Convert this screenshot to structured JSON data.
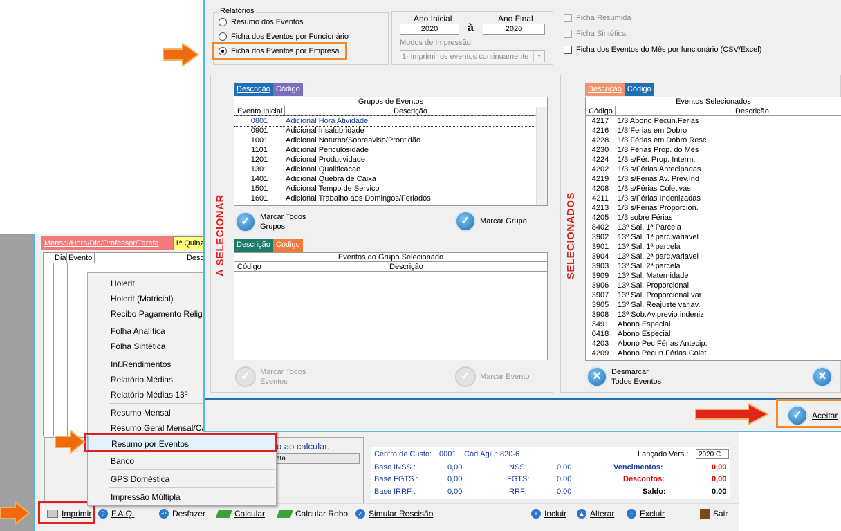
{
  "background": {
    "mode_tab": "Mensal/Hora/Dia/Professor/Tarefa",
    "quinz_tab": "1ª Quinz",
    "grid_cols": [
      "Dia",
      "Evento",
      "Desc"
    ],
    "calc_msg": "o ao calcular.",
    "calc_bar": "ata",
    "totals": {
      "centro_label": "Centro de Custo:",
      "centro_val": "0001",
      "cod_label": "Cód.Agil.:",
      "cod_val": "820-6",
      "versao_label": "Lançado Vers.:",
      "versao_val": "2020 C",
      "inss_base_label": "Base INSS :",
      "inss_base_val": "0,00",
      "inss_label": "INSS:",
      "inss_val": "0,00",
      "venc_label": "Vencimentos:",
      "venc_val": "0,00",
      "fgts_base_label": "Base FGTS :",
      "fgts_base_val": "0,00",
      "fgts_label": "FGTS:",
      "fgts_val": "0,00",
      "desc_label": "Descontos:",
      "desc_val": "0,00",
      "irrf_base_label": "Base IRRF :",
      "irrf_base_val": "0,00",
      "irrf_label": "IRRF:",
      "irrf_val": "0,00",
      "saldo_label": "Saldo:",
      "saldo_val": "0,00"
    }
  },
  "context_menu": {
    "items": [
      "Holerit",
      "Holerit (Matricial)",
      "Recibo Pagamento Religi",
      "Folha Analítica",
      "Folha Sintética",
      "Inf.Rendimentos",
      "Relatório Médias",
      "Relatório Médias 13º",
      "Resumo Mensal",
      "Resumo Geral Mensal/Ca",
      "Resumo por Eventos",
      "Banco",
      "GPS Doméstica",
      "Impressão Múltipla"
    ]
  },
  "toolbar": {
    "imprimir": "Imprimir",
    "faq": "F.A.Q.",
    "desfazer": "Desfazer",
    "calcular": "Calcular",
    "calcular_robo": "Calcular Robo",
    "simular": "Simular Rescisão",
    "incluir": "Incluir",
    "alterar": "Alterar",
    "excluir": "Excluir",
    "sair": "Sair"
  },
  "dialog": {
    "relatorios_label": "Relatórios",
    "radios": [
      "Resumo dos Eventos",
      "Ficha dos Eventos por Funcionário",
      "Ficha dos Eventos por Empresa"
    ],
    "ano_inicial_label": "Ano Inicial",
    "ano_final_label": "Ano Final",
    "ano_inicial": "2020",
    "ano_final": "2020",
    "a_label": "à",
    "modos_label": "Modos de Impressão",
    "modos_value": "1- imprimir os eventos continuamente",
    "check_ficha_resumida": "Ficha Resumida",
    "check_ficha_sintetica": "Ficha Sintética",
    "check_ficha_mes": "Ficha dos Eventos do Mês por funcionário  (CSV/Excel)",
    "a_selecionar": "A SELECIONAR",
    "selecionados": "SELECIONADOS",
    "tab_descricao": "Descrição",
    "tab_codigo": "Código",
    "grupos": {
      "title": "Grupos de Eventos",
      "col1": "Evento Inicial",
      "col2": "Descrição",
      "rows": [
        [
          "0801",
          "Adicional Hora Atividade"
        ],
        [
          "0901",
          "Adicional Insalubridade"
        ],
        [
          "1001",
          "Adicional Noturno/Sobreaviso/Prontidão"
        ],
        [
          "1101",
          "Adicional Periculosidade"
        ],
        [
          "1201",
          "Adicional Produtividade"
        ],
        [
          "1301",
          "Adicional Qualificacao"
        ],
        [
          "1401",
          "Adicional Quebra de Caixa"
        ],
        [
          "1501",
          "Adicional Tempo de Servico"
        ],
        [
          "1601",
          "Adicional Trabalho aos Domingos/Feriados"
        ]
      ]
    },
    "marcar_todos_grupos": "Marcar Todos\nGrupos",
    "marcar_grupo": "Marcar Grupo",
    "eventos_grupo": {
      "title": "Eventos do Grupo Selecionado",
      "col1": "Código",
      "col2": "Descrição"
    },
    "marcar_todos_eventos": "Marcar Todos\nEventos",
    "marcar_evento": "Marcar Evento",
    "selecionados_tbl": {
      "title": "Eventos Selecionados",
      "col1": "Código",
      "col2": "Descrição",
      "rows": [
        [
          "4217",
          "1/3 Abono Pecun.Ferias"
        ],
        [
          "4216",
          "1/3 Ferias em Dobro"
        ],
        [
          "4228",
          "1/3 Férias em Dobro Resc."
        ],
        [
          "4230",
          "1/3 Férias Prop. do Mês"
        ],
        [
          "4224",
          "1/3 s/Fér. Prop. Interm."
        ],
        [
          "4202",
          "1/3 s/Férias Antecipadas"
        ],
        [
          "4219",
          "1/3 s/Férias Av. Prév.Ind"
        ],
        [
          "4208",
          "1/3 s/Férias Coletivas"
        ],
        [
          "4211",
          "1/3 s/Férias Indenizadas"
        ],
        [
          "4213",
          "1/3 s/Férias Proporcion."
        ],
        [
          "4205",
          "1/3 sobre Férias"
        ],
        [
          "8402",
          "13º Sal. 1ª Parcela"
        ],
        [
          "3902",
          "13º Sal. 1ª parc.variavel"
        ],
        [
          "3901",
          "13º Sal. 1ª parcela"
        ],
        [
          "3904",
          "13º Sal. 2ª parc.variavel"
        ],
        [
          "3903",
          "13º Sal. 2ª parcela"
        ],
        [
          "3909",
          "13º Sal. Maternidade"
        ],
        [
          "3906",
          "13º Sal. Proporcional"
        ],
        [
          "3907",
          "13º Sal. Proporcional var"
        ],
        [
          "3905",
          "13º Sal. Reajuste variav."
        ],
        [
          "3908",
          "13º Sob.Av.previo indeniz"
        ],
        [
          "3491",
          "Abono Especial"
        ],
        [
          "0418",
          "Abono Especial"
        ],
        [
          "4203",
          "Abono Pec.Férias Antecip."
        ],
        [
          "4209",
          "Abono Pecun.Férias Colet."
        ]
      ]
    },
    "desmarcar_todos": "Desmarcar\nTodos Eventos",
    "aceitar": "Aceitar"
  }
}
